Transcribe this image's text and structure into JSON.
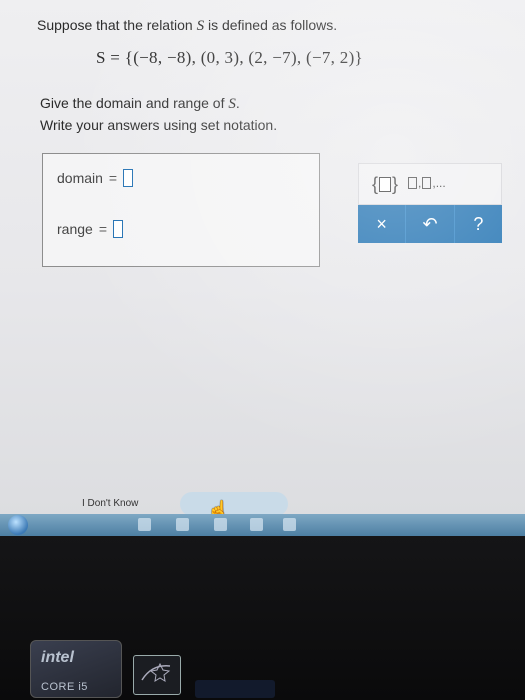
{
  "question": {
    "text_before": "Suppose that the relation",
    "variable": "S",
    "text_after": "is defined as follows."
  },
  "relation": "S = {(−8, −8), (0, 3), (2, −7), (−7, 2)}",
  "instructions": {
    "line1_before": "Give the domain and range of",
    "line1_var": "S",
    "line1_after": ".",
    "line2": "Write your answers using set notation."
  },
  "answers": {
    "domain_label": "domain",
    "range_label": "range",
    "equals": "=",
    "domain_value": "",
    "range_value": ""
  },
  "palette": {
    "set_brace_left": "{",
    "set_brace_right": "}",
    "list_separator": ",",
    "list_ellipsis": "...",
    "clear_symbol": "×",
    "undo_symbol": "↶",
    "help_symbol": "?"
  },
  "footer": {
    "dont_know": "I Don't Know"
  },
  "colors": {
    "accent_blue": "#1a6eb0",
    "slot_border": "#1f6fb2"
  },
  "icons": [
    "set-brace-icon",
    "list-icon",
    "clear-icon",
    "undo-icon",
    "help-icon",
    "hand-cursor-icon",
    "start-orb-icon"
  ]
}
